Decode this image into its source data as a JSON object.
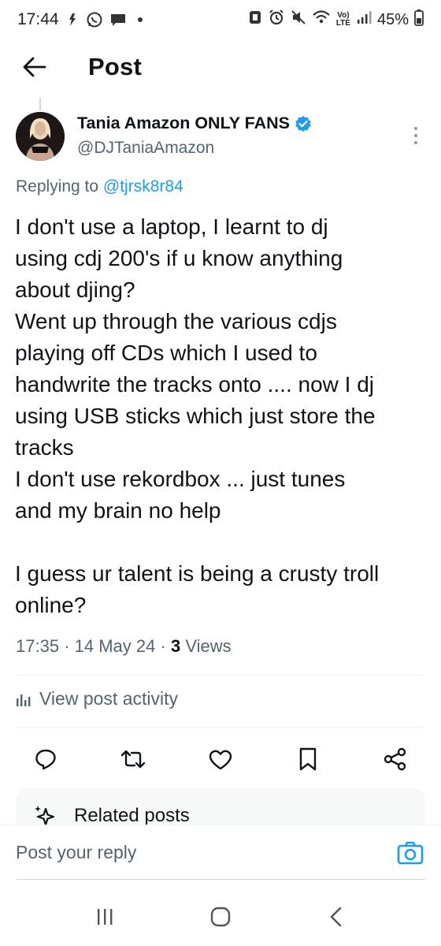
{
  "status_bar": {
    "time": "17:44",
    "battery": "45%",
    "volte": "Vo)",
    "lte": "LTE"
  },
  "header": {
    "title": "Post"
  },
  "post": {
    "author_name": "Tania Amazon ONLY FANS",
    "author_handle": "@DJTaniaAmazon",
    "replying_prefix": "Replying to ",
    "replying_handle": "@tjrsk8r84",
    "text_lines": [
      "I don't use a laptop, I learnt to dj",
      "using cdj 200's if u know anything",
      "about djing?",
      "Went up through the various cdjs",
      "playing off CDs which I used to",
      "handwrite the tracks onto .... now I dj",
      "using USB sticks which just store the",
      "tracks",
      "I don't use rekordbox ... just tunes",
      "and my brain no help",
      "",
      "I guess ur talent is being a crusty troll",
      "online?"
    ],
    "time": "17:35",
    "date": "14 May 24",
    "separator": "·",
    "views_count": "3",
    "views_label": "Views"
  },
  "activity_label": "View post activity",
  "actions": [
    "reply-icon",
    "retweet-icon",
    "like-icon",
    "bookmark-icon",
    "share-icon"
  ],
  "related_label": "Related posts",
  "reply": {
    "placeholder": "Post your reply"
  },
  "colors": {
    "accent": "#1d9bf0",
    "secondary_text": "#536471",
    "primary_text": "#0f1419"
  }
}
